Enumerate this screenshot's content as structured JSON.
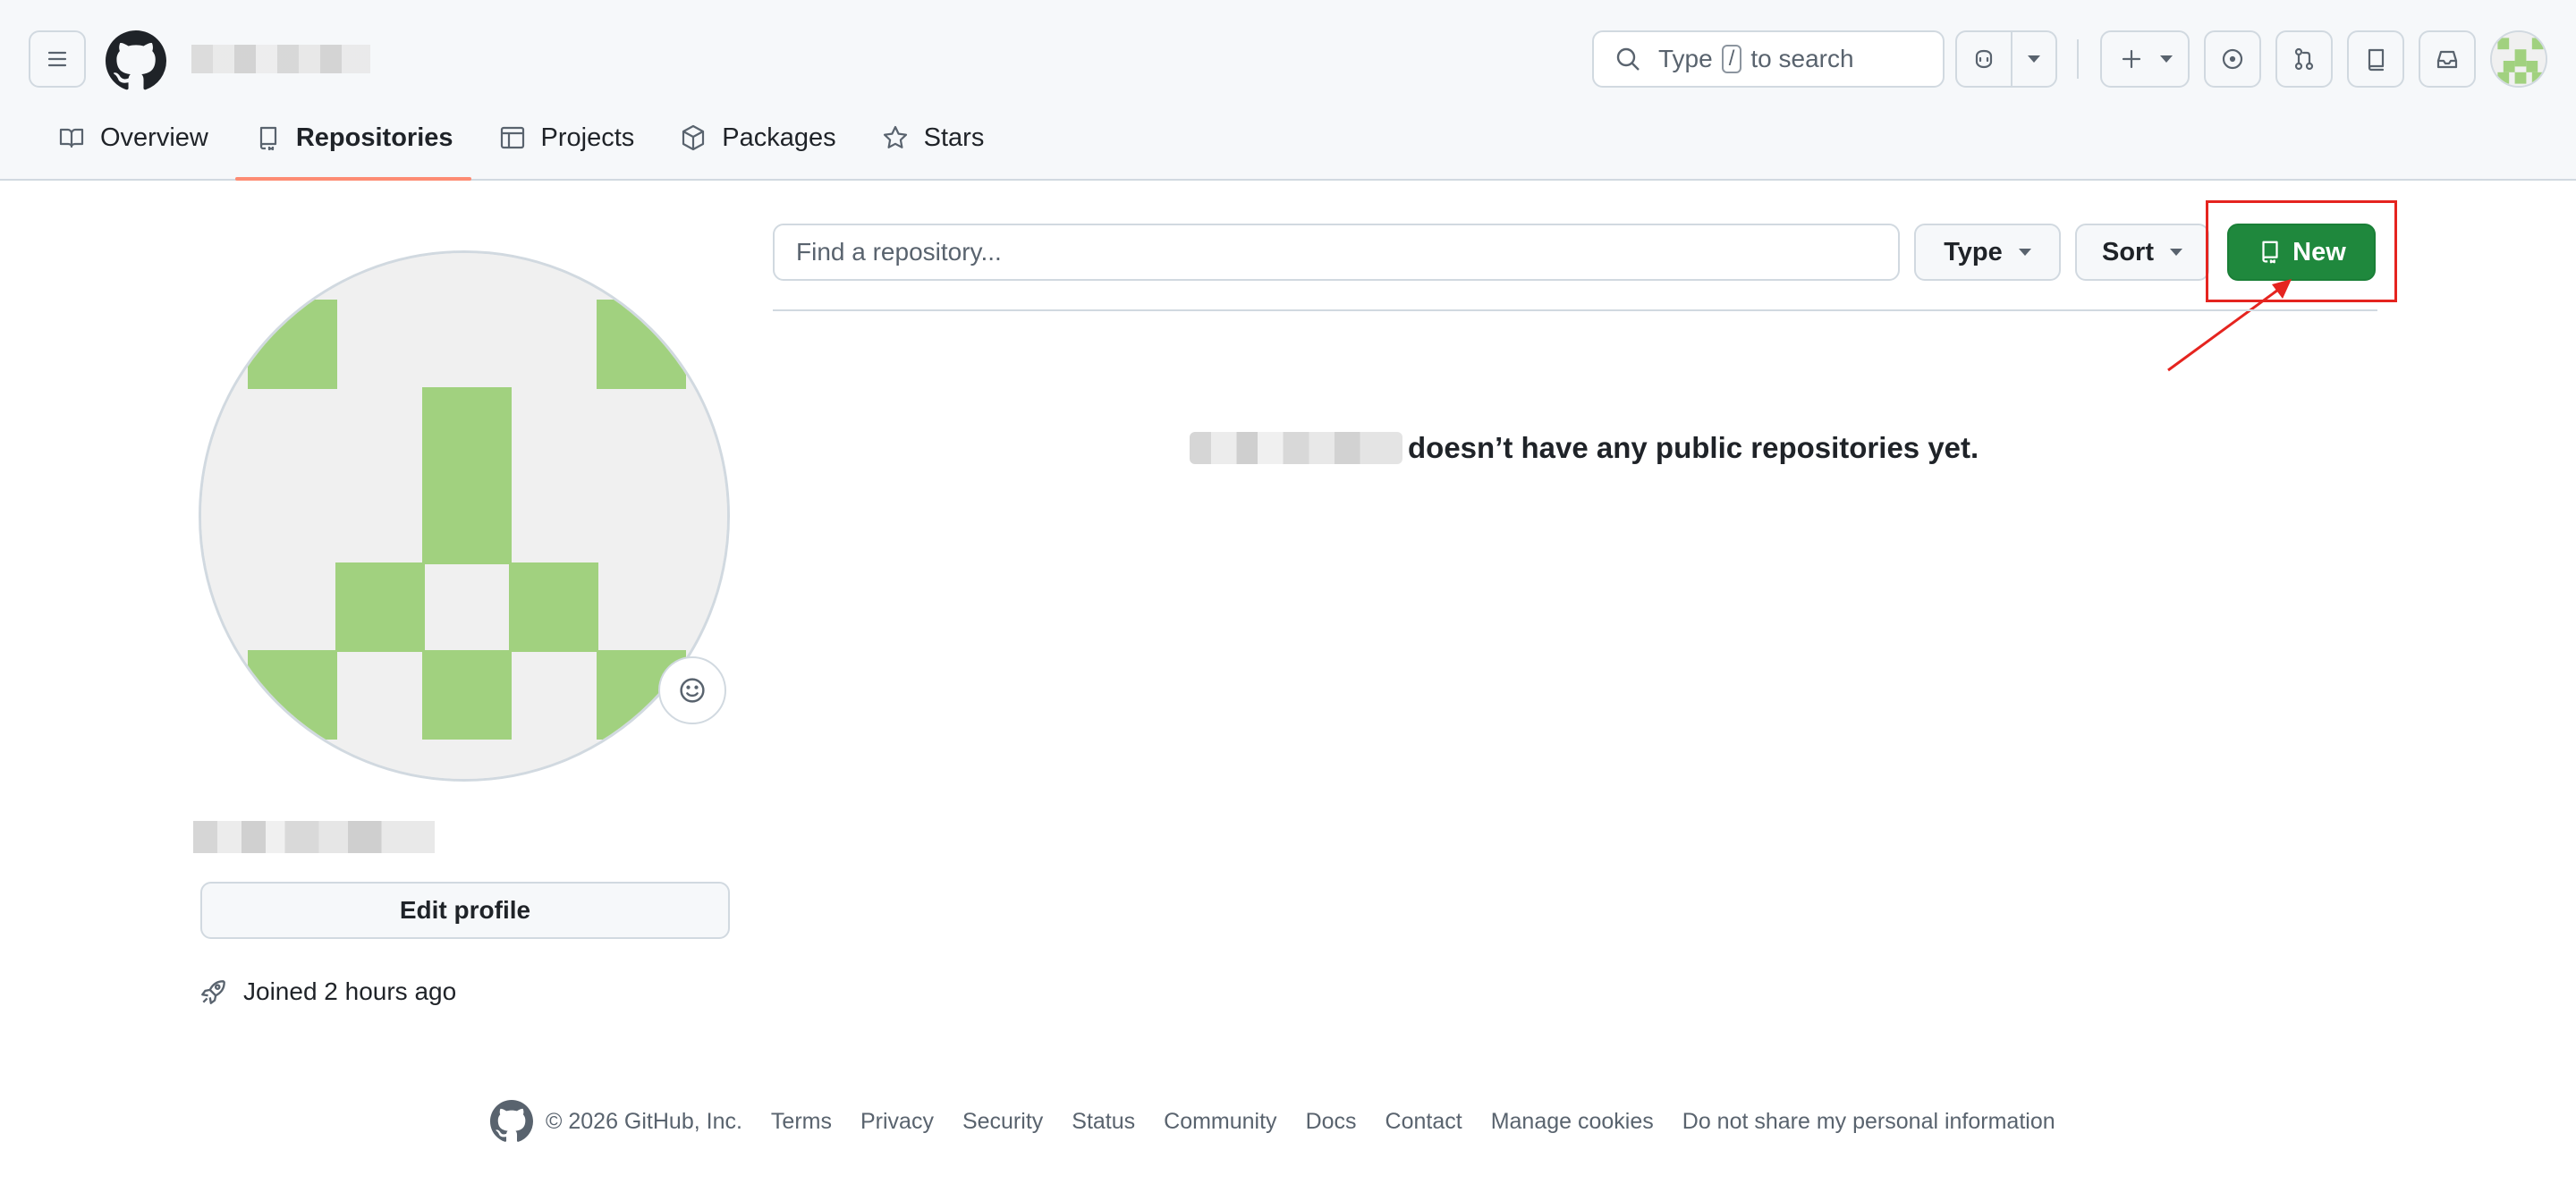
{
  "header": {
    "menu_icon": "hamburger-icon",
    "logo_icon": "github-logo-icon",
    "search": {
      "prefix": "Type",
      "key": "/",
      "suffix": "to search"
    },
    "actions": [
      "copilot-icon",
      "plus-icon",
      "issues-icon",
      "pull-requests-icon",
      "repo-icon",
      "inbox-icon"
    ]
  },
  "tabs": [
    {
      "label": "Overview",
      "icon": "book-icon"
    },
    {
      "label": "Repositories",
      "icon": "repo-icon",
      "active": true
    },
    {
      "label": "Projects",
      "icon": "table-icon"
    },
    {
      "label": "Packages",
      "icon": "package-icon"
    },
    {
      "label": "Stars",
      "icon": "star-icon"
    }
  ],
  "profile": {
    "edit_label": "Edit profile",
    "joined": "Joined 2 hours ago"
  },
  "repos": {
    "search_placeholder": "Find a repository...",
    "type_label": "Type",
    "sort_label": "Sort",
    "new_label": "New",
    "empty_message": "doesn’t have any public repositories yet."
  },
  "footer": {
    "copyright": "© 2026 GitHub, Inc.",
    "links": [
      "Terms",
      "Privacy",
      "Security",
      "Status",
      "Community",
      "Docs",
      "Contact",
      "Manage cookies",
      "Do not share my personal information"
    ]
  },
  "colors": {
    "accent_green": "#1f883d",
    "tab_underline": "#fd8c73",
    "annotation_red": "#e5241f",
    "avatar_green": "#a1d17f"
  }
}
